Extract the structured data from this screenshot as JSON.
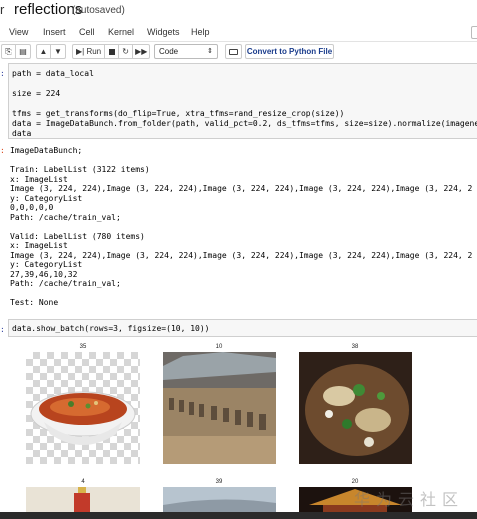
{
  "header": {
    "logo_fragment": "r",
    "title": "reflections",
    "autosave": "(autosaved)"
  },
  "menu": [
    "View",
    "Insert",
    "Cell",
    "Kernel",
    "Widgets",
    "Help"
  ],
  "toolbar": {
    "run_label": "Run",
    "cell_type": "Code",
    "convert_label": "Convert to Python File"
  },
  "prompts": {
    "in": ":",
    "out": ":"
  },
  "cell1": {
    "line1": "path = data_local",
    "line2": "size = 224",
    "line3": "tfms = get_transforms(do_flip=True, xtra_tfms=rand_resize_crop(size))",
    "line4": "data = ImageDataBunch.from_folder(path, valid_pct=0.2, ds_tfms=tfms, size=size).normalize(imagene",
    "line5": "data"
  },
  "output1": {
    "text": "ImageDataBunch;\n\nTrain: LabelList (3122 items)\nx: ImageList\nImage (3, 224, 224),Image (3, 224, 224),Image (3, 224, 224),Image (3, 224, 224),Image (3, 224, 2\ny: CategoryList\n0,0,0,0,0\nPath: /cache/train_val;\n\nValid: LabelList (780 items)\nx: ImageList\nImage (3, 224, 224),Image (3, 224, 224),Image (3, 224, 224),Image (3, 224, 224),Image (3, 224, 2\ny: CategoryList\n27,39,46,10,32\nPath: /cache/train_val;\n\nTest: None"
  },
  "cell2": {
    "code": "data.show_batch(rows=3, figsize=(10, 10))"
  },
  "batch": {
    "labels": [
      "35",
      "10",
      "38",
      "4",
      "39",
      "20"
    ]
  },
  "watermark": "华为云社区"
}
